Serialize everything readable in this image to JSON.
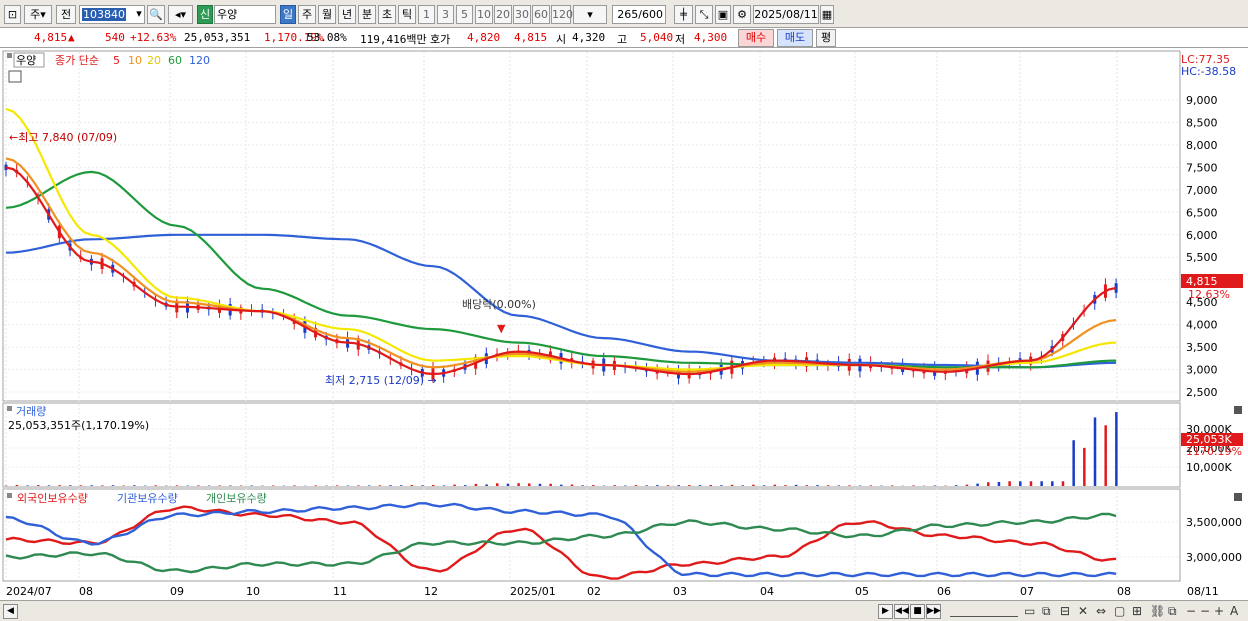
{
  "toolbar": {
    "period_main": "주",
    "prev_label": "전",
    "stock_code": "103840",
    "badge": "신",
    "stock_name": "우양",
    "periods": [
      "일",
      "주",
      "월",
      "년",
      "분",
      "초",
      "틱"
    ],
    "minutes": [
      "1",
      "3",
      "5",
      "10",
      "20",
      "30",
      "60",
      "120"
    ],
    "count_value": "265",
    "count_max": "/600",
    "date": "2025/08/11"
  },
  "quote": {
    "price": "4,815",
    "arrow": "▲",
    "change": "540",
    "change_pct": "+12.63%",
    "volume": "25,053,351",
    "volume_pct": "1,170.19%",
    "turnover": "53.08%",
    "amount": "119,416백만",
    "ask_label": "호가",
    "ask_1": "4,820",
    "ask_2": "4,815",
    "open_label": "시",
    "open": "4,320",
    "high_label": "고",
    "high": "5,040",
    "low_label": "저",
    "low": "4,300",
    "buy_btn": "매수",
    "sell_btn": "매도",
    "eval_btn": "평"
  },
  "price_panel": {
    "title": "우양",
    "ma_label": "종가 단순",
    "ma_periods": [
      "5",
      "10",
      "20",
      "60",
      "120"
    ],
    "ma_colors": [
      "#e01a1a",
      "#f09020",
      "#f5e800",
      "#1e9a3c",
      "#3060d8"
    ],
    "lc": "LC:77.35",
    "hc": "HC:-38.58",
    "current_price_label": "4,815",
    "current_change_label": "12.63%",
    "annotation_high": "최고 7,840 (07/09)",
    "annotation_low": "최저 2,715 (12/09)",
    "annotation_div": "배당락(0.00%)",
    "y_ticks": [
      "2,500",
      "3,000",
      "3,500",
      "4,000",
      "4,500",
      "5,000",
      "5,500",
      "6,000",
      "6,500",
      "7,000",
      "7,500",
      "8,000",
      "8,500",
      "9,000"
    ]
  },
  "volume_panel": {
    "title": "거래량",
    "value_label": "25,053,351주(1,170.19%)",
    "y_ticks": [
      "10,000K",
      "20,000K",
      "30,000K"
    ],
    "current_label": "25,053K",
    "current_pct": "1170.19%"
  },
  "holdings_panel": {
    "legend": [
      "외국인보유수량",
      "기관보유수량",
      "개인보유수량"
    ],
    "legend_colors": [
      "#e01a1a",
      "#3060d8",
      "#2e8a50"
    ],
    "y_ticks": [
      "3,000,000",
      "3,500,000"
    ]
  },
  "x_axis": {
    "labels": [
      "2024/07",
      "08",
      "09",
      "10",
      "11",
      "12",
      "2025/01",
      "02",
      "03",
      "04",
      "05",
      "06",
      "07",
      "08"
    ],
    "right_label": "08/11"
  },
  "chart_data": {
    "type": "line",
    "title": "우양",
    "x": [
      "2024/07",
      "08",
      "09",
      "10",
      "11",
      "12",
      "2025/01",
      "02",
      "03",
      "04",
      "05",
      "06",
      "07",
      "08"
    ],
    "ylim": [
      2500,
      9000
    ],
    "series": [
      {
        "name": "5",
        "values": [
          7500,
          5400,
          4400,
          4300,
          3600,
          2900,
          3400,
          3100,
          2900,
          3200,
          3100,
          2950,
          3200,
          4815
        ]
      },
      {
        "name": "10",
        "values": [
          7700,
          5600,
          4500,
          4300,
          3700,
          3050,
          3350,
          3100,
          2950,
          3150,
          3100,
          3000,
          3200,
          4100
        ]
      },
      {
        "name": "20",
        "values": [
          8800,
          6000,
          4600,
          4300,
          3900,
          3200,
          3300,
          3100,
          3000,
          3100,
          3100,
          3000,
          3150,
          3600
        ]
      },
      {
        "name": "60",
        "values": [
          6600,
          7400,
          6200,
          4800,
          4200,
          3900,
          3600,
          3300,
          3150,
          3100,
          3100,
          3050,
          3050,
          3200
        ]
      },
      {
        "name": "120",
        "values": [
          5600,
          5900,
          6000,
          6000,
          5900,
          5300,
          4200,
          3700,
          3400,
          3200,
          3150,
          3100,
          3050,
          3150
        ]
      }
    ],
    "volume_values_k": [
      400,
      300,
      250,
      200,
      250,
      400,
      1200,
      300,
      400,
      500,
      250,
      200,
      3000,
      32000
    ]
  }
}
